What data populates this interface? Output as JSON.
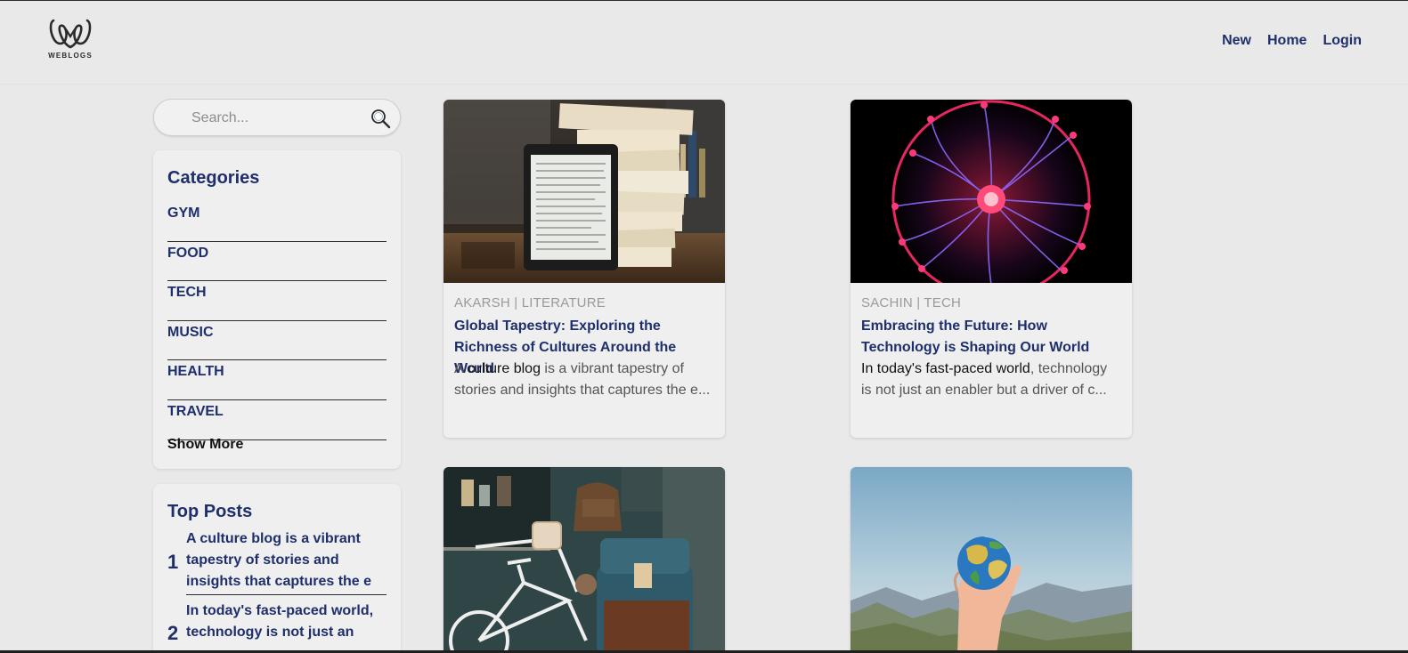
{
  "header": {
    "logo_text": "WEBLOGS",
    "nav": [
      "New",
      "Home",
      "Login"
    ]
  },
  "search": {
    "placeholder": "Search..."
  },
  "categories": {
    "title": "Categories",
    "items": [
      "GYM",
      "FOOD",
      "TECH",
      "MUSIC",
      "HEALTH",
      "TRAVEL"
    ],
    "show_more": "Show More"
  },
  "top_posts": {
    "title": "Top Posts",
    "items": [
      {
        "rank": "1",
        "text": "A culture blog is a vibrant tapestry of stories and insights that captures the e"
      },
      {
        "rank": "2",
        "text": "In today's fast-paced world, technology is not just an"
      }
    ]
  },
  "posts": [
    {
      "meta": "AKARSH | LITERATURE",
      "title": "Global Tapestry: Exploring the Richness of Cultures Around the World",
      "excerpt_bold": "culture blog",
      "excerpt_pre": "A",
      "excerpt_post": "is a vibrant tapestry of stories and insights that captures the e..."
    },
    {
      "meta": "SACHIN | TECH",
      "title": "Embracing the Future: How Technology is Shaping Our World",
      "excerpt_bold": "In today's fast-paced world",
      "excerpt_pre": "",
      "excerpt_post": ", technology is not just an enabler but a driver of c..."
    },
    {
      "meta": "",
      "title": "",
      "excerpt_pre": "",
      "excerpt_bold": "",
      "excerpt_post": ""
    },
    {
      "meta": "",
      "title": "",
      "excerpt_pre": "",
      "excerpt_bold": "",
      "excerpt_post": ""
    }
  ],
  "colors": {
    "background": "#e9e9ea",
    "accent": "#1e2f6b",
    "panel": "#efeff0",
    "muted": "#9a9a9a"
  }
}
